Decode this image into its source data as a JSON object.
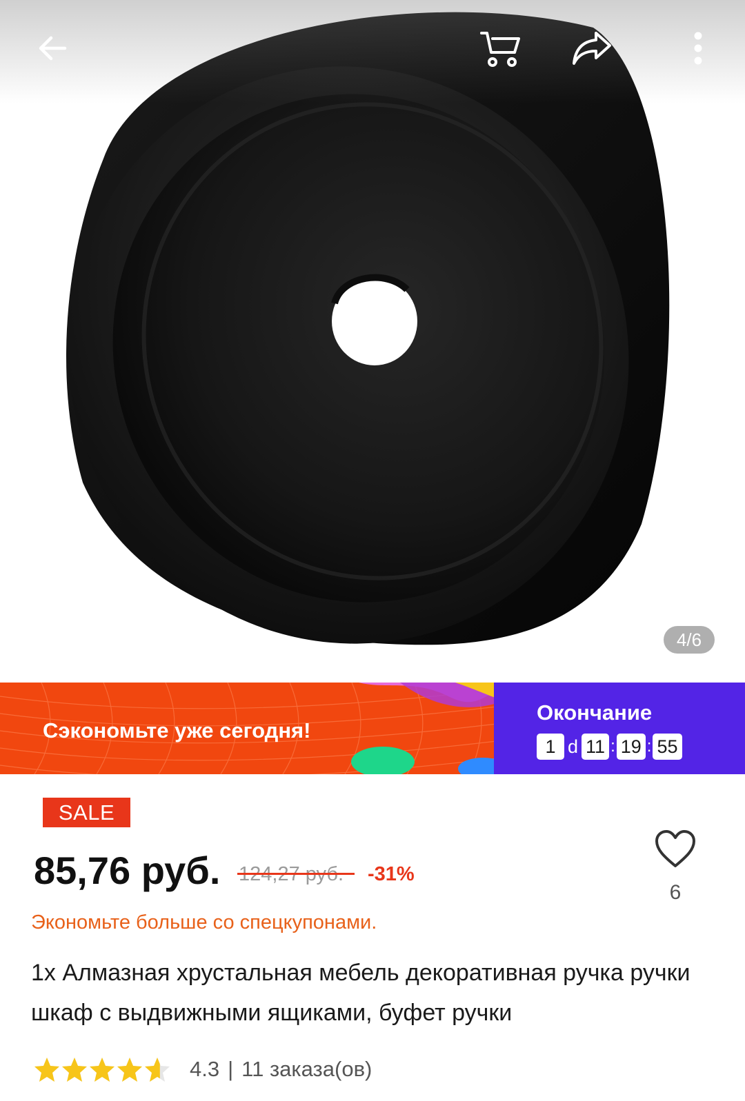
{
  "gallery": {
    "image_index": "4/6",
    "back_icon": "arrow-left-icon",
    "cart_icon": "cart-icon",
    "share_icon": "share-icon",
    "more_icon": "more-vertical-icon"
  },
  "banner": {
    "promo_text": "Сэкономьте уже сегодня!",
    "end_label": "Окончание",
    "timer": {
      "days": "1",
      "days_unit": "d",
      "hours": "11",
      "minutes": "19",
      "seconds": "55"
    }
  },
  "product": {
    "badge": "SALE",
    "price": "85,76 руб.",
    "old_price": "124,27 руб.",
    "discount": "-31%",
    "wishlist_count": "6",
    "coupon_text": "Экономьте больше со спецкупонами.",
    "title": "1x Алмазная хрустальная мебель декоративная ручка ручки шкаф с выдвижными ящиками, буфет ручки",
    "rating": {
      "value": "4.3",
      "stars": 4.3,
      "separator": "|",
      "orders": "11 заказа(ов)"
    }
  },
  "colors": {
    "accent_red": "#e8361a",
    "banner_orange": "#f1470f",
    "banner_purple": "#5324e6",
    "coupon_orange": "#e8611a",
    "star_yellow": "#f7c519"
  }
}
